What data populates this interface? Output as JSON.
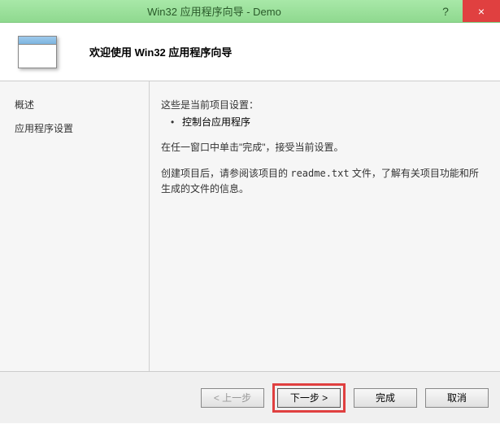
{
  "titlebar": {
    "title": "Win32 应用程序向导 - Demo",
    "help": "?",
    "close": "×"
  },
  "header": {
    "welcome": "欢迎使用 Win32 应用程序向导"
  },
  "sidebar": {
    "items": [
      {
        "label": "概述"
      },
      {
        "label": "应用程序设置"
      }
    ]
  },
  "content": {
    "settings_intro": "这些是当前项目设置：",
    "bullet1": "控制台应用程序",
    "para1": "在任一窗口中单击\"完成\"，接受当前设置。",
    "para2_a": "创建项目后，请参阅该项目的 ",
    "para2_file": "readme.txt",
    "para2_b": " 文件，了解有关项目功能和所生成的文件的信息。"
  },
  "footer": {
    "prev": "< 上一步",
    "next": "下一步 >",
    "finish": "完成",
    "cancel": "取消"
  }
}
